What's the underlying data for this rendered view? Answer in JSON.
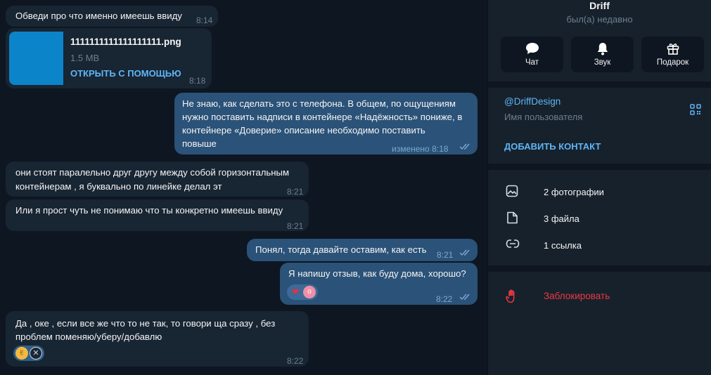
{
  "chat": {
    "messages": [
      {
        "text": "Обведи про что именно имеешь ввиду",
        "time": "8:14"
      },
      {
        "file_name": "1111111111111111111.png",
        "file_size": "1.5 MB",
        "open_label": "ОТКРЫТЬ С ПОМОЩЬЮ",
        "time": "8:18"
      },
      {
        "lines": [
          "Не знаю, как сделать это с телефона. В общем, по ощущениям",
          "нужно поставить надписи в контейнере «Надёжность» пониже, в",
          "контейнере «Доверие» описание необходимо поставить",
          "повыше"
        ],
        "time": "изменено 8:18"
      },
      {
        "lines": [
          "они стоят паралельно друг другу между собой горизонтальным",
          "контейнерам , я буквально по линейке делал эт"
        ],
        "time": "8:21"
      },
      {
        "text": "Или я прост чуть не понимаю что ты конкретно имеешь ввиду",
        "time": "8:21"
      },
      {
        "text": "Понял,  тогда давайте оставим, как есть",
        "time": "8:21"
      },
      {
        "text": "Я напишу отзыв, как буду дома, хорошо?",
        "time": "8:22"
      },
      {
        "lines": [
          "Да , оке , если все же что то не так, то говори ща сразу , без",
          "проблем поменяю/уберу/добавлю"
        ],
        "time": "8:22"
      }
    ]
  },
  "panel": {
    "name": "Driff",
    "status": "был(а) недавно",
    "actions": [
      {
        "label": "Чат",
        "icon": "chat-icon"
      },
      {
        "label": "Звук",
        "icon": "bell-icon"
      },
      {
        "label": "Подарок",
        "icon": "gift-icon"
      }
    ],
    "username": "@DriffDesign",
    "username_label": "Имя пользователя",
    "add_contact": "ДОБАВИТЬ КОНТАКТ",
    "media": [
      {
        "label": "2 фотографии",
        "icon": "photo-icon"
      },
      {
        "label": "3 файла",
        "icon": "file-icon"
      },
      {
        "label": "1 ссылка",
        "icon": "link-icon"
      }
    ],
    "block": "Заблокировать"
  },
  "colors": {
    "chat_bg": "#0e1621",
    "incoming": "#182533",
    "outgoing": "#2b5278",
    "accent": "#5eb5f7",
    "danger": "#ec3942"
  }
}
